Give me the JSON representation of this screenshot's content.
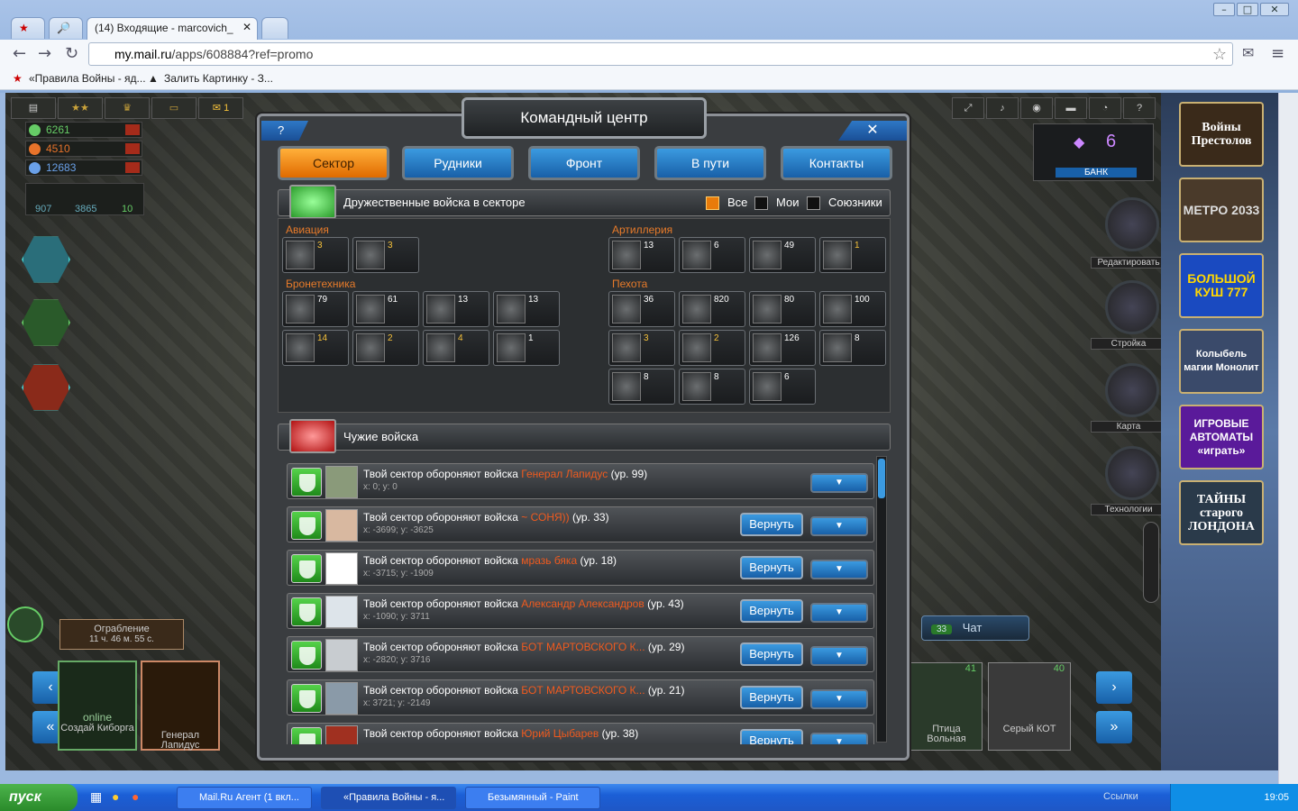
{
  "browser": {
    "tabs": [
      "(14) Входящие - marcovich_"
    ],
    "url_host": "my.mail.ru",
    "url_path": "/apps/608884?ref=promo",
    "bookmarks": [
      "«Правила Войны - яд...",
      "Залить Картинку - З..."
    ]
  },
  "hud": {
    "resources": [
      "6261",
      "4510",
      "12683"
    ],
    "stats": [
      "907",
      "3865",
      "10"
    ],
    "robbery_label": "Ограбление",
    "robbery_time": "11 ч. 46 м. 55 с.",
    "friends": [
      {
        "name": "Создай Киборга",
        "status": "online"
      },
      {
        "name": "Генерал Лапидус"
      }
    ],
    "right_labels": [
      "Редактировать",
      "Стройка",
      "Карта",
      "Технологии"
    ],
    "bank_value": "6",
    "bank_label": "БАНК",
    "chat_count": "33",
    "chat_label": "Чат",
    "neighbors": [
      {
        "name": "Птица Вольная",
        "level": "41"
      },
      {
        "name": "Серый КОТ",
        "level": "40"
      }
    ]
  },
  "modal": {
    "title": "Командный центр",
    "help": "?",
    "close": "✕",
    "tabs": [
      "Сектор",
      "Рудники",
      "Фронт",
      "В пути",
      "Контакты"
    ],
    "friendly_header": "Дружественные войска в секторе",
    "filters": [
      "Все",
      "Мои",
      "Союзники"
    ],
    "categories": {
      "aviation": "Авиация",
      "artillery": "Артиллерия",
      "armor": "Бронетехника",
      "infantry": "Пехота"
    },
    "units": {
      "aviation": [
        "3",
        "3"
      ],
      "artillery": [
        "13",
        "6",
        "49",
        "1"
      ],
      "armor": [
        "79",
        "61",
        "13",
        "13",
        "14",
        "2",
        "4",
        "1"
      ],
      "infantry": [
        "36",
        "820",
        "80",
        "100",
        "3",
        "2",
        "126",
        "8",
        "8",
        "8",
        "6"
      ]
    },
    "foreign_header": "Чужие войска",
    "row_prefix": "Твой сектор обороняют войска",
    "return_label": "Вернуть",
    "rows": [
      {
        "name": "Генерал Лапидус",
        "level": "(ур. 99)",
        "coords": "x: 0; y: 0",
        "can_return": false
      },
      {
        "name": "~ СОНЯ)) ",
        "level": "(ур. 33)",
        "coords": "x: -3699; y: -3625",
        "can_return": true
      },
      {
        "name": "мразь бяка",
        "level": "(ур. 18)",
        "coords": "x: -3715; y: -1909",
        "can_return": true
      },
      {
        "name": "Александр Александров",
        "level": "(ур. 43)",
        "coords": "x: -1090; y: 3711",
        "can_return": true
      },
      {
        "name": "БОТ МАРТОВСКОГО К...",
        "level": "(ур. 29)",
        "coords": "x: -2820; y: 3716",
        "can_return": true
      },
      {
        "name": "БОТ МАРТОВСКОГО К...",
        "level": "(ур. 21)",
        "coords": "x: 3721; y: -2149",
        "can_return": true
      },
      {
        "name": "Юрий Цыбарев",
        "level": "(ур. 38)",
        "coords": "",
        "can_return": true
      }
    ]
  },
  "ads": [
    "Войны Престолов",
    "МЕТРО 2033",
    "БОЛЬШОЙ КУШ 777",
    "Колыбель магии Монолит",
    "ИГРОВЫЕ АВТОМАТЫ «играть»",
    "ТАЙНЫ старого ЛОНДОНА"
  ],
  "taskbar": {
    "start": "пуск",
    "tasks": [
      "Mail.Ru Агент (1 вкл...",
      "«Правила Войны - я...",
      "Безымянный - Paint"
    ],
    "links": "Ссылки",
    "clock": "19:05"
  },
  "colors": {
    "accent_orange": "#e87b0a",
    "name_red": "#f05a1e",
    "button_blue": "#1860a8"
  }
}
